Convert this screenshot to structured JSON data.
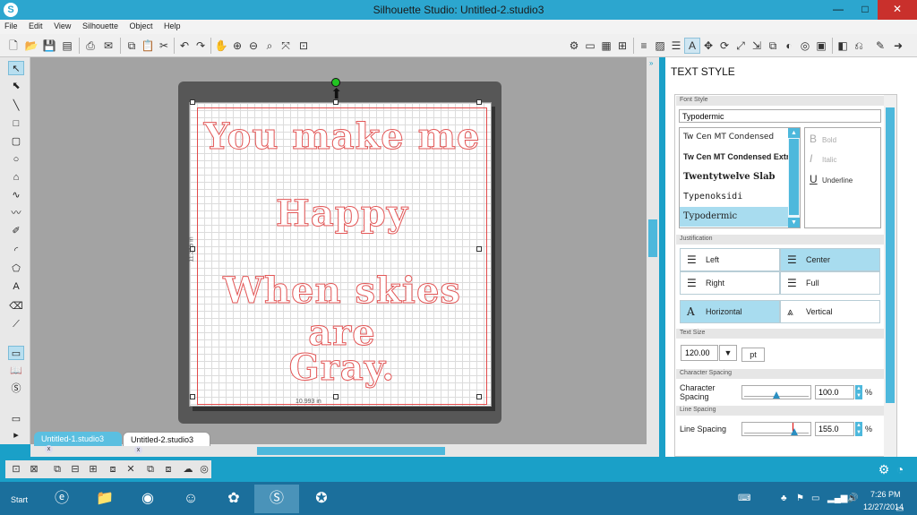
{
  "window": {
    "title": "Silhouette Studio: Untitled-2.studio3",
    "app_icon": "silhouette-s-icon",
    "controls": {
      "minimize": "—",
      "maximize": "□",
      "close": "✕"
    }
  },
  "menu": {
    "items": [
      "File",
      "Edit",
      "View",
      "Silhouette",
      "Object",
      "Help"
    ]
  },
  "canvas": {
    "lines": [
      "You make me",
      "Happy",
      "When skies are",
      "Gray."
    ],
    "width_label": "10.993 in",
    "height_label": "11.315 in"
  },
  "tabs": [
    {
      "label": "Untitled-1.studio3",
      "close": "x",
      "active": false
    },
    {
      "label": "Untitled-2.studio3",
      "close": "x",
      "active": true
    }
  ],
  "panel": {
    "title": "TEXT STYLE",
    "font_style_header": "Font Style",
    "font_input_value": "Typodermic",
    "font_list": [
      "Tw Cen MT Condensed",
      "Tw Cen MT Condensed Extra",
      "Twentytwelve Slab",
      "Typenoksidi",
      "Typodermic"
    ],
    "font_list_selected": "Typodermic",
    "style_options": {
      "bold": "Bold",
      "italic": "Italic",
      "underline": "Underline"
    },
    "justification_header": "Justification",
    "justification": {
      "left": "Left",
      "center": "Center",
      "right": "Right",
      "full": "Full"
    },
    "justification_active": "Center",
    "orientation": {
      "horizontal": "Horizontal",
      "vertical": "Vertical"
    },
    "orientation_active": "Horizontal",
    "text_size_header": "Text Size",
    "text_size_value": "120.00",
    "text_size_unit": "pt",
    "char_spacing_header": "Character Spacing",
    "char_spacing_label_1": "Character",
    "char_spacing_label_2": "Spacing",
    "char_spacing_value": "100.0",
    "char_spacing_unit": "%",
    "line_spacing_header": "Line Spacing",
    "line_spacing_label": "Line Spacing",
    "line_spacing_value": "155.0",
    "line_spacing_unit": "%"
  },
  "taskbar": {
    "start": "Start",
    "time": "7:26 PM",
    "date": "12/27/2014",
    "apps": [
      "internet-explorer-icon",
      "file-explorer-icon",
      "chrome-icon",
      "portrait-app-icon",
      "picasa-icon",
      "silhouette-studio-icon",
      "avast-icon"
    ]
  },
  "colors": {
    "accent": "#1aa0c8",
    "text_outline": "#e25656",
    "selection": "#a8dcef"
  }
}
